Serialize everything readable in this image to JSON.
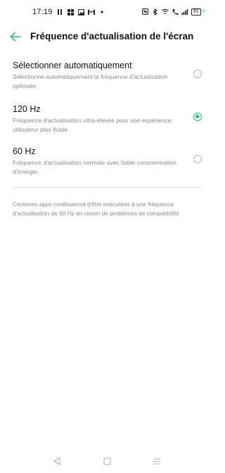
{
  "status_bar": {
    "time": "17:19",
    "battery": "91",
    "icons_left": [
      "pause-icon",
      "grid-icon",
      "photo-icon",
      "gmail-icon",
      "dot-icon"
    ],
    "icons_right": [
      "nfc-icon",
      "bluetooth-icon",
      "wifi-icon",
      "call-icon",
      "signal-icon",
      "battery-icon",
      "charging-icon"
    ]
  },
  "header": {
    "title": "Fréquence d'actualisation de l'écran",
    "accent_color": "#1fbf7a"
  },
  "options": [
    {
      "label": "Sélectionner automatiquement",
      "description": "Sélectionne automatiquement la fréquence d'actualisation optimale.",
      "selected": false
    },
    {
      "label": "120 Hz",
      "description": "Fréquence d'actualisation ultra-élevée pour une expérience utilisateur plus fluide.",
      "selected": true
    },
    {
      "label": "60 Hz",
      "description": "Fréquence d'actualisation normale avec faible consommation d'énergie.",
      "selected": false
    }
  ],
  "note": "Certaines apps continueront d'être exécutées à une fréquence d'actualisation de 60 Hz en raison de problèmes de compatibilité.",
  "nav_bar": {
    "items": [
      "back-triangle-icon",
      "home-square-icon",
      "recents-menu-icon"
    ]
  }
}
